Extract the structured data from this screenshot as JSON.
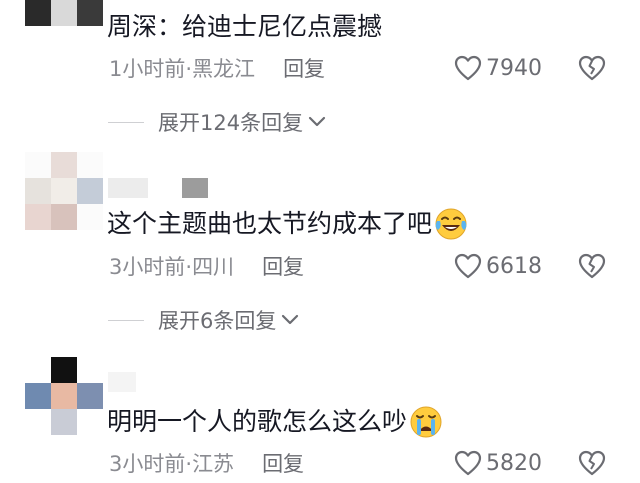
{
  "comments": [
    {
      "text": "周深：给迪士尼亿点震撼",
      "time": "1小时前",
      "location": "黑龙江",
      "reply_label": "回复",
      "likes": "7940",
      "expand_label": "展开124条回复"
    },
    {
      "text": "这个主题曲也太节约成本了吧",
      "time": "3小时前",
      "location": "四川",
      "reply_label": "回复",
      "likes": "6618",
      "expand_label": "展开6条回复",
      "emoji": "tears-of-joy-emoji"
    },
    {
      "text": "明明一个人的歌怎么这么吵",
      "time": "3小时前",
      "location": "江苏",
      "reply_label": "回复",
      "likes": "5820",
      "emoji": "crying-emoji"
    }
  ],
  "separator": " · ",
  "icons": {
    "like": "heart-outline-icon",
    "dislike": "broken-heart-icon",
    "expand": "chevron-down-icon"
  },
  "colors": {
    "text": "#161823",
    "meta": "#8a8b91",
    "action": "#6b6c72"
  }
}
